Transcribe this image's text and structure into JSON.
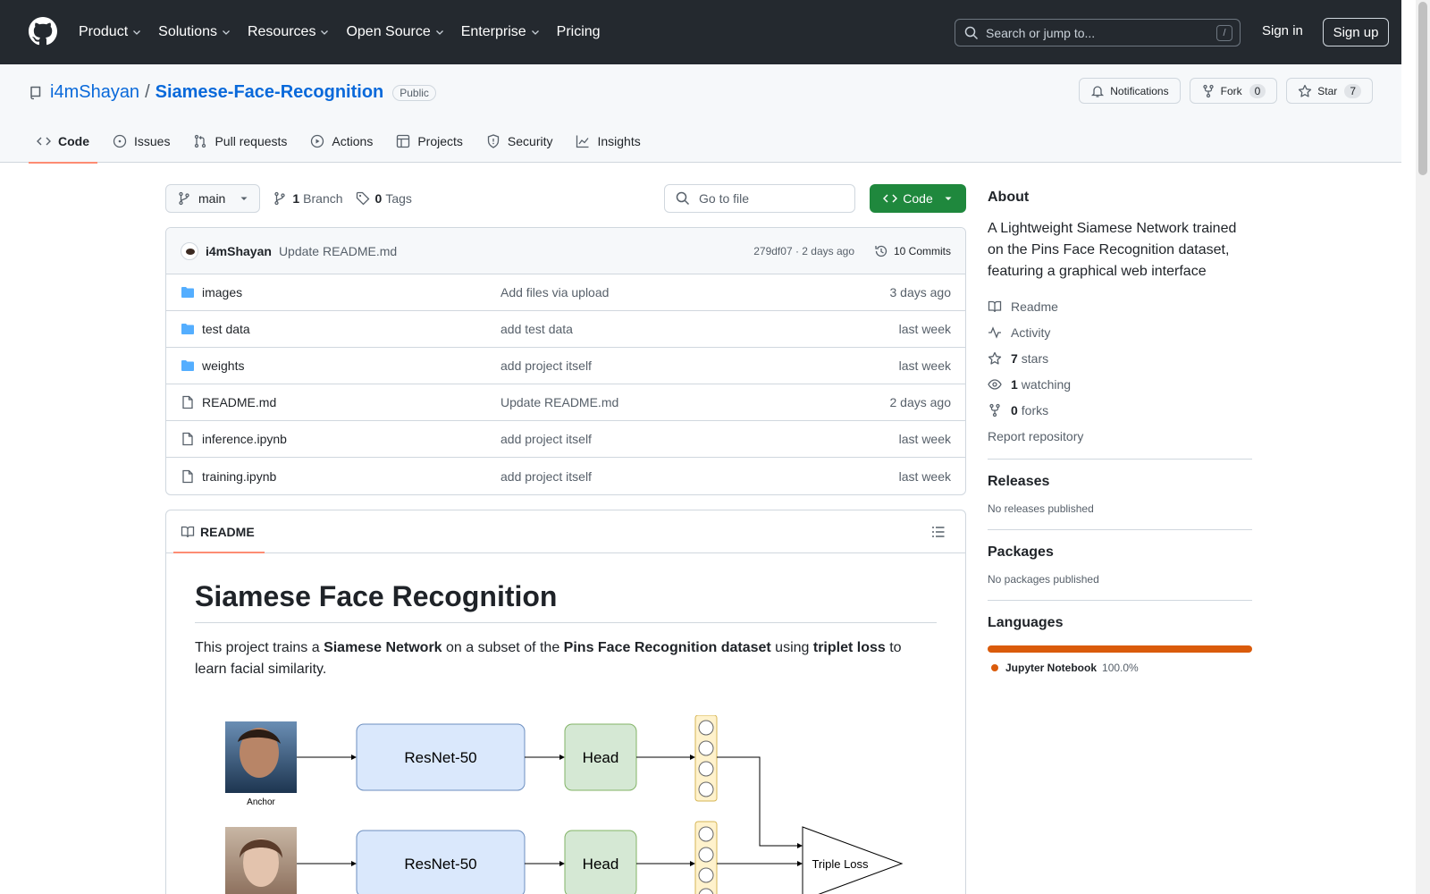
{
  "header": {
    "nav": [
      "Product",
      "Solutions",
      "Resources",
      "Open Source",
      "Enterprise",
      "Pricing"
    ],
    "search_placeholder": "Search or jump to...",
    "search_key": "/",
    "sign_in": "Sign in",
    "sign_up": "Sign up"
  },
  "repo": {
    "owner": "i4mShayan",
    "name": "Siamese-Face-Recognition",
    "visibility": "Public",
    "notifications": "Notifications",
    "fork_label": "Fork",
    "fork_count": "0",
    "star_label": "Star",
    "star_count": "7"
  },
  "tabs": [
    "Code",
    "Issues",
    "Pull requests",
    "Actions",
    "Projects",
    "Security",
    "Insights"
  ],
  "toolbar": {
    "branch": "main",
    "branch_count": "1",
    "branch_label": "Branch",
    "tag_count": "0",
    "tag_label": "Tags",
    "goto_placeholder": "Go to file",
    "code_button": "Code"
  },
  "commit": {
    "author": "i4mShayan",
    "message": "Update README.md",
    "sha_time": "279df07 · 2 days ago",
    "commits": "10 Commits"
  },
  "files": [
    {
      "type": "dir",
      "name": "images",
      "message": "Add files via upload",
      "date": "3 days ago"
    },
    {
      "type": "dir",
      "name": "test data",
      "message": "add test data",
      "date": "last week"
    },
    {
      "type": "dir",
      "name": "weights",
      "message": "add project itself",
      "date": "last week"
    },
    {
      "type": "file",
      "name": "README.md",
      "message": "Update README.md",
      "date": "2 days ago"
    },
    {
      "type": "file",
      "name": "inference.ipynb",
      "message": "add project itself",
      "date": "last week"
    },
    {
      "type": "file",
      "name": "training.ipynb",
      "message": "add project itself",
      "date": "last week"
    }
  ],
  "readme": {
    "tab": "README",
    "title": "Siamese Face Recognition",
    "p_pre": "This project trains a ",
    "p_b1": "Siamese Network",
    "p_mid1": " on a subset of the ",
    "p_b2": "Pins Face Recognition dataset",
    "p_mid2": " using ",
    "p_b3": "triplet loss",
    "p_post": " to learn facial similarity.",
    "diagram": {
      "backbone": "ResNet-50",
      "head": "Head",
      "anchor": "Anchor",
      "loss": "Triple Loss"
    }
  },
  "sidebar": {
    "about_title": "About",
    "about_text": "A Lightweight Siamese Network trained on the Pins Face Recognition dataset, featuring a graphical web interface",
    "readme": "Readme",
    "activity": "Activity",
    "stars_count": "7",
    "stars_label": "stars",
    "watching_count": "1",
    "watching_label": "watching",
    "forks_count": "0",
    "forks_label": "forks",
    "report": "Report repository",
    "releases_title": "Releases",
    "releases_text": "No releases published",
    "packages_title": "Packages",
    "packages_text": "No packages published",
    "languages_title": "Languages",
    "language": "Jupyter Notebook",
    "language_pct": "100.0%"
  },
  "colors": {
    "header_bg": "#24292f",
    "accent": "#0969da",
    "green": "#1f883d",
    "tab_underline": "#fd8c73",
    "jupyter": "#DA5B0B"
  }
}
